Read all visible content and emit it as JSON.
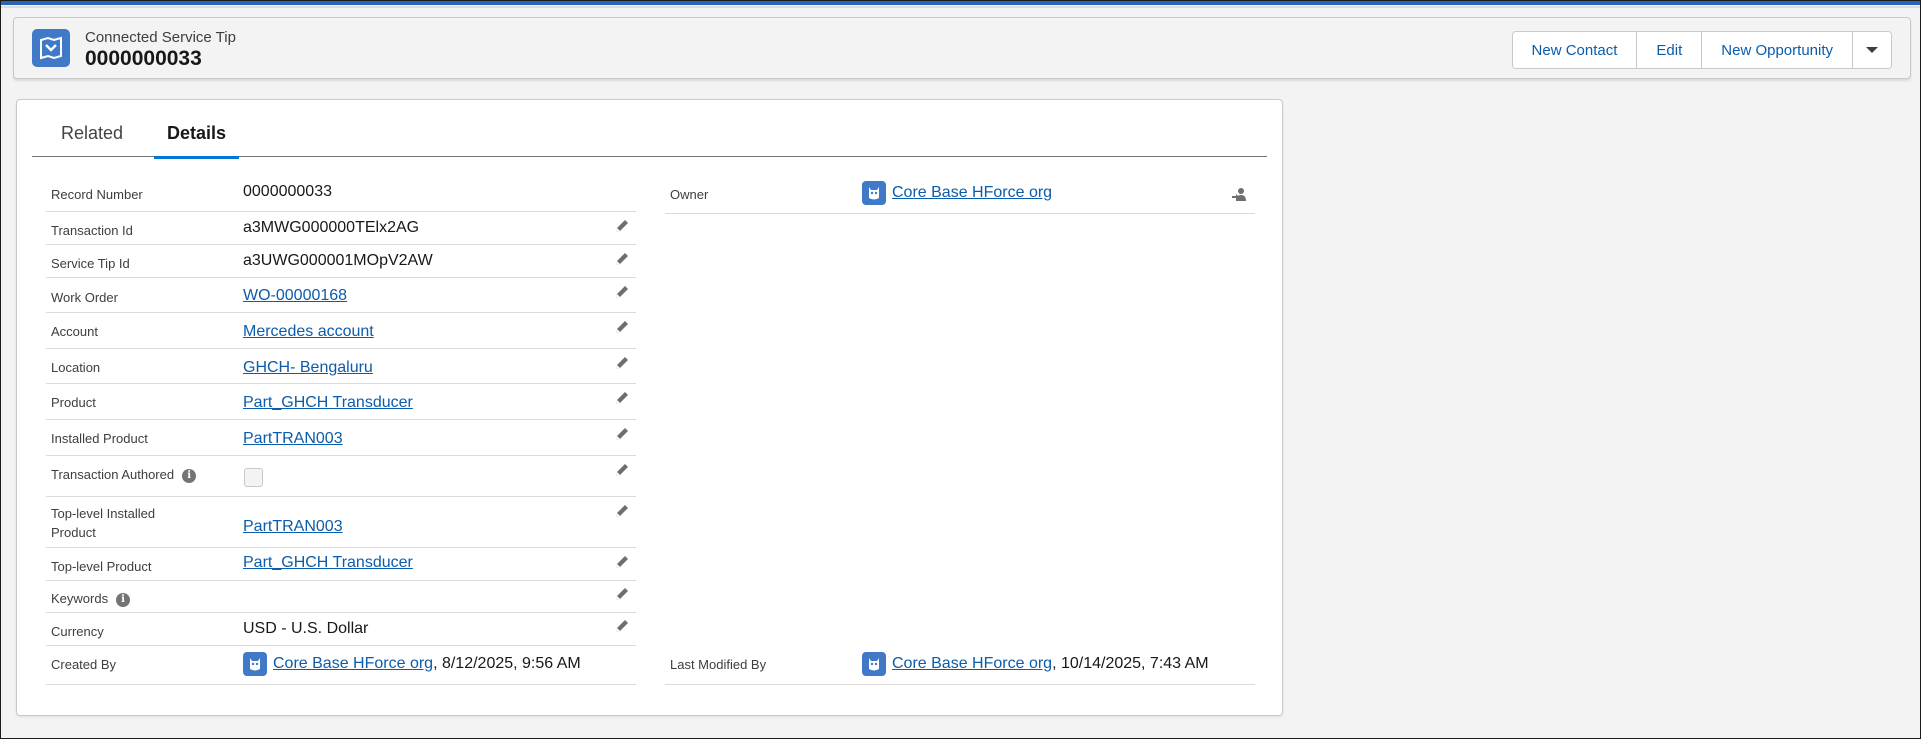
{
  "header": {
    "object_type": "Connected Service Tip",
    "record_name": "0000000033",
    "buttons": [
      "New Contact",
      "Edit",
      "New Opportunity"
    ]
  },
  "tabs": [
    {
      "label": "Related",
      "active": false
    },
    {
      "label": "Details",
      "active": true
    }
  ],
  "left_fields": {
    "record_number": {
      "label": "Record Number",
      "value": "0000000033"
    },
    "transaction_id": {
      "label": "Transaction Id",
      "value": "a3MWG000000TElx2AG"
    },
    "service_tip_id": {
      "label": "Service Tip Id",
      "value": "a3UWG000001MOpV2AW"
    },
    "work_order": {
      "label": "Work Order",
      "value": "WO-00000168"
    },
    "account": {
      "label": "Account",
      "value": "Mercedes account"
    },
    "location": {
      "label": "Location",
      "value": "GHCH- Bengaluru"
    },
    "product": {
      "label": "Product",
      "value": "Part_GHCH Transducer"
    },
    "installed_product": {
      "label": "Installed Product",
      "value": "PartTRAN003"
    },
    "transaction_authored": {
      "label": "Transaction Authored",
      "checked": false
    },
    "top_installed_product": {
      "label": "Top-level Installed Product",
      "value": "PartTRAN003"
    },
    "top_product": {
      "label": "Top-level Product",
      "value": "Part_GHCH Transducer"
    },
    "keywords": {
      "label": "Keywords",
      "value": ""
    },
    "currency": {
      "label": "Currency",
      "value": "USD - U.S. Dollar"
    },
    "created_by": {
      "label": "Created By",
      "user": "Core Base HForce org",
      "date": ", 8/12/2025, 9:56 AM"
    }
  },
  "right_fields": {
    "owner": {
      "label": "Owner",
      "user": "Core Base HForce org"
    },
    "last_modified_by": {
      "label": "Last Modified By",
      "user": "Core Base HForce org",
      "date": ", 10/14/2025, 7:43 AM"
    }
  },
  "colors": {
    "brand": "#0176d3",
    "link": "#0b5cab",
    "icon_bg": "#3f79c8"
  }
}
